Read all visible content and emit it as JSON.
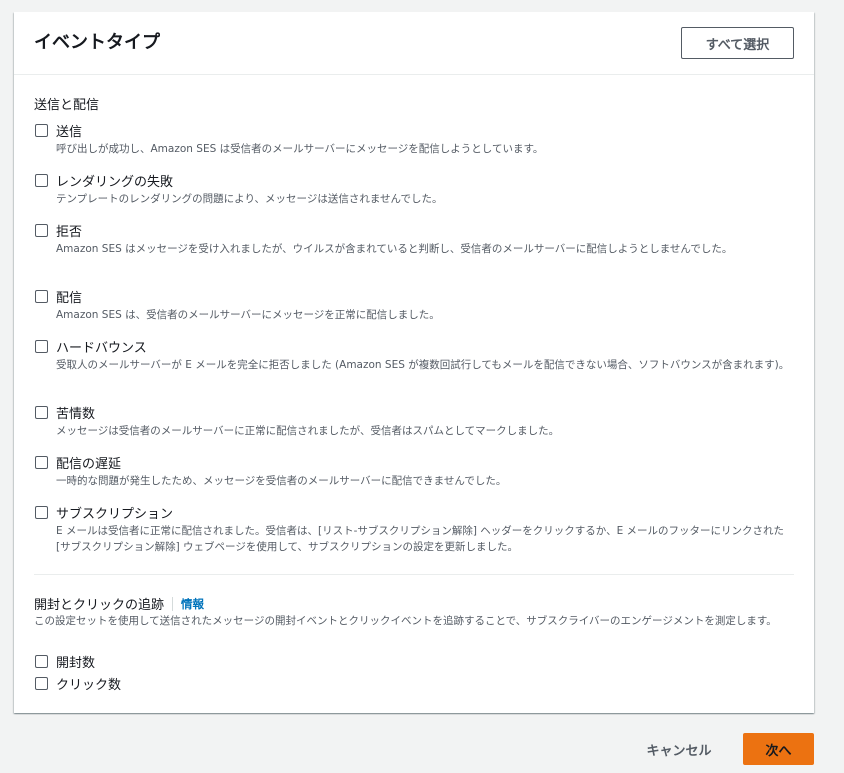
{
  "panel": {
    "title": "イベントタイプ",
    "select_all_label": "すべて選択"
  },
  "sending": {
    "section_label": "送信と配信",
    "options": [
      {
        "label": "送信",
        "description": "呼び出しが成功し、Amazon SES は受信者のメールサーバーにメッセージを配信しようとしています。",
        "checked": false
      },
      {
        "label": "レンダリングの失敗",
        "description": "テンプレートのレンダリングの問題により、メッセージは送信されませんでした。",
        "checked": false
      },
      {
        "label": "拒否",
        "description": "Amazon SES はメッセージを受け入れましたが、ウイルスが含まれていると判断し、受信者のメールサーバーに配信しようとしませんでした。",
        "checked": false
      },
      {
        "label": "配信",
        "description": "Amazon SES は、受信者のメールサーバーにメッセージを正常に配信しました。",
        "checked": false
      },
      {
        "label": "ハードバウンス",
        "description": "受取人のメールサーバーが E メールを完全に拒否しました (Amazon SES が複数回試行してもメールを配信できない場合、ソフトバウンスが含まれます)。",
        "checked": false
      },
      {
        "label": "苦情数",
        "description": "メッセージは受信者のメールサーバーに正常に配信されましたが、受信者はスパムとしてマークしました。",
        "checked": false
      },
      {
        "label": "配信の遅延",
        "description": "一時的な問題が発生したため、メッセージを受信者のメールサーバーに配信できませんでした。",
        "checked": false
      },
      {
        "label": "サブスクリプション",
        "description": "E メールは受信者に正常に配信されました。受信者は、[リスト-サブスクリプション解除] ヘッダーをクリックするか、E メールのフッターにリンクされた [サブスクリプション解除] ウェブページを使用して、サブスクリプションの設定を更新しました。",
        "checked": false
      }
    ]
  },
  "tracking": {
    "title": "開封とクリックの追跡",
    "info_link": "情報",
    "description": "この設定セットを使用して送信されたメッセージの開封イベントとクリックイベントを追跡することで、サブスクライバーのエンゲージメントを測定します。",
    "options": [
      {
        "label": "開封数",
        "checked": false
      },
      {
        "label": "クリック数",
        "checked": false
      }
    ]
  },
  "footer": {
    "cancel_label": "キャンセル",
    "next_label": "次へ"
  },
  "colors": {
    "accent": "#ec7211",
    "link": "#0073bb",
    "background": "#f2f3f3"
  }
}
